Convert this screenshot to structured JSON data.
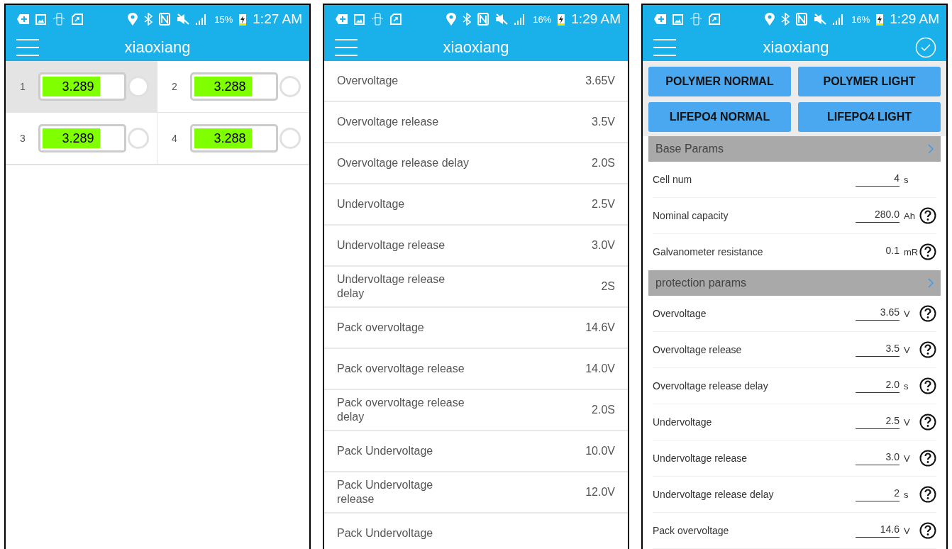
{
  "screens": [
    {
      "status_bar": {
        "battery": "15%",
        "time": "1:27 AM"
      },
      "title": "xiaoxiang",
      "cells": [
        {
          "index": "1",
          "voltage": "3.289",
          "level": 0.72,
          "selected": true
        },
        {
          "index": "2",
          "voltage": "3.288",
          "level": 0.72,
          "selected": false
        },
        {
          "index": "3",
          "voltage": "3.289",
          "level": 0.72,
          "selected": false
        },
        {
          "index": "4",
          "voltage": "3.288",
          "level": 0.72,
          "selected": false
        }
      ]
    },
    {
      "status_bar": {
        "battery": "16%",
        "time": "1:29 AM"
      },
      "title": "xiaoxiang",
      "params": [
        {
          "label": "Overvoltage",
          "value": "3.65V"
        },
        {
          "label": "Overvoltage release",
          "value": "3.5V"
        },
        {
          "label": "Overvoltage release delay",
          "value": "2.0S"
        },
        {
          "label": "Undervoltage",
          "value": "2.5V"
        },
        {
          "label": "Undervoltage release",
          "value": "3.0V"
        },
        {
          "label": "Undervoltage release delay",
          "value": "2S"
        },
        {
          "label": "Pack overvoltage",
          "value": "14.6V"
        },
        {
          "label": "Pack overvoltage release",
          "value": "14.0V"
        },
        {
          "label": "Pack overvoltage release delay",
          "value": "2.0S"
        },
        {
          "label": "Pack Undervoltage",
          "value": "10.0V"
        },
        {
          "label": "Pack Undervoltage release",
          "value": "12.0V"
        },
        {
          "label": "Pack Undervoltage"
        }
      ]
    },
    {
      "status_bar": {
        "battery": "16%",
        "time": "1:29 AM"
      },
      "title": "xiaoxiang",
      "confirm_button": true,
      "presets": [
        "POLYMER NORMAL",
        "POLYMER LIGHT",
        "LIFEPO4 NORMAL",
        "LIFEPO4 LIGHT"
      ],
      "sections": [
        {
          "title": "Base Params",
          "rows": [
            {
              "label": "Cell num",
              "value": "4",
              "unit": "s",
              "editable": true,
              "help": false
            },
            {
              "label": "Nominal capacity",
              "value": "280.0",
              "unit": "Ah",
              "editable": true,
              "help": true
            },
            {
              "label": "Galvanometer resistance",
              "value": "0.1",
              "unit": "mR",
              "editable": false,
              "help": true
            }
          ]
        },
        {
          "title": "protection params",
          "rows": [
            {
              "label": "Overvoltage",
              "value": "3.65",
              "unit": "V",
              "editable": true,
              "help": true
            },
            {
              "label": "Overvoltage release",
              "value": "3.5",
              "unit": "V",
              "editable": true,
              "help": true
            },
            {
              "label": "Overvoltage release delay",
              "value": "2.0",
              "unit": "s",
              "editable": true,
              "help": true
            },
            {
              "label": "Undervoltage",
              "value": "2.5",
              "unit": "V",
              "editable": true,
              "help": true
            },
            {
              "label": "Undervoltage release",
              "value": "3.0",
              "unit": "V",
              "editable": true,
              "help": true
            },
            {
              "label": "Undervoltage release delay",
              "value": "2",
              "unit": "s",
              "editable": true,
              "help": true
            },
            {
              "label": "Pack overvoltage",
              "value": "14.6",
              "unit": "V",
              "editable": true,
              "help": true
            }
          ]
        }
      ]
    }
  ]
}
